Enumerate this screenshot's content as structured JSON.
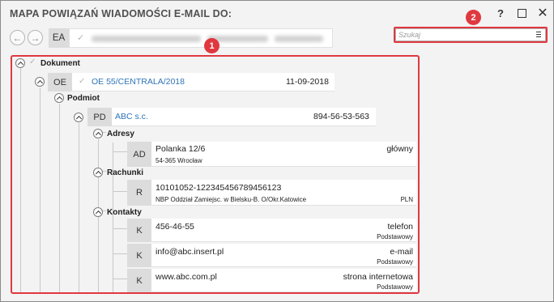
{
  "window": {
    "title": "MAPA POWIĄZAŃ WIADOMOŚCI E-MAIL DO:",
    "help_label": "?",
    "close_label": "✕"
  },
  "nav": {
    "back_label": "←",
    "forward_label": "→",
    "ea_tag": "EA"
  },
  "search": {
    "placeholder": "Szukaj"
  },
  "badges": {
    "one": "1",
    "two": "2"
  },
  "tree": {
    "root": {
      "label": "Dokument"
    },
    "document": {
      "tag": "OE",
      "number": "OE 55/CENTRALA/2018",
      "date": "11-09-2018"
    },
    "subject_group": {
      "label": "Podmiot"
    },
    "subject": {
      "tag": "PD",
      "name": "ABC s.c.",
      "nip": "894-56-53-563"
    },
    "addresses": {
      "label": "Adresy",
      "items": [
        {
          "tag": "AD",
          "line1": "Polanka  12/6",
          "line2": "54-365 Wrocław",
          "type": "główny"
        }
      ]
    },
    "accounts": {
      "label": "Rachunki",
      "items": [
        {
          "tag": "R",
          "number": "10101052-122345456789456123",
          "bank": "NBP Oddział Zamiejsc. w Bielsku-B.  O/Okr.Katowice",
          "currency": "PLN"
        }
      ]
    },
    "contacts": {
      "label": "Kontakty",
      "items": [
        {
          "tag": "K",
          "value": "456-46-55",
          "type": "telefon",
          "sub": "Podstawowy"
        },
        {
          "tag": "K",
          "value": "info@abc.insert.pl",
          "type": "e-mail",
          "sub": "Podstawowy"
        },
        {
          "tag": "K",
          "value": "www.abc.com.pl",
          "type": "strona internetowa",
          "sub": "Podstawowy"
        }
      ]
    }
  },
  "colors": {
    "accent": "#e0383f",
    "link": "#2e74b5",
    "tag_bg": "#dcdcdc",
    "window_bg": "#f3f3f3"
  }
}
